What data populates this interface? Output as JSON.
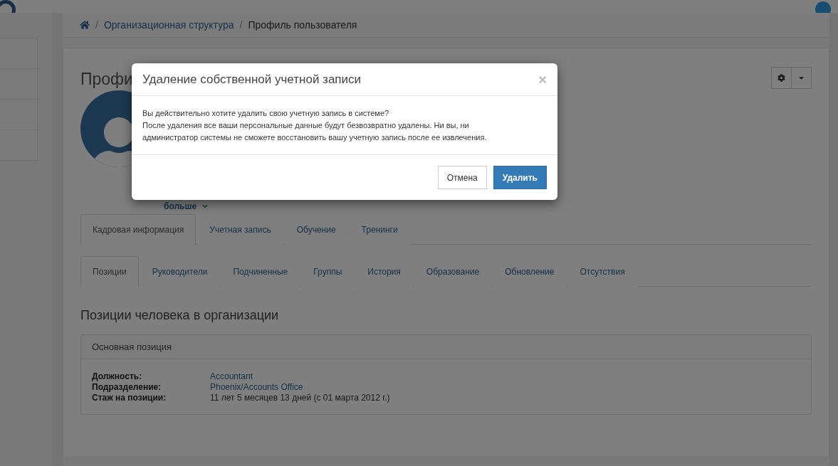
{
  "breadcrumb": {
    "separator": "/",
    "items": [
      "Организационная структура",
      "Профиль пользователя"
    ]
  },
  "profile": {
    "title": "Профи",
    "more_link": "больше"
  },
  "main_tabs": [
    {
      "label": "Кадровая информация",
      "selected": true
    },
    {
      "label": "Учетная запись",
      "selected": false
    },
    {
      "label": "Обучение",
      "selected": false
    },
    {
      "label": "Тренинги",
      "selected": false
    }
  ],
  "sub_tabs": [
    {
      "label": "Позиции",
      "selected": true
    },
    {
      "label": "Руководители",
      "selected": false
    },
    {
      "label": "Подчиненные",
      "selected": false
    },
    {
      "label": "Группы",
      "selected": false
    },
    {
      "label": "История",
      "selected": false
    },
    {
      "label": "Образование",
      "selected": false
    },
    {
      "label": "Обновление",
      "selected": false
    },
    {
      "label": "Отсутствия",
      "selected": false
    }
  ],
  "section_title": "Позиции человека в организации",
  "position_panel": {
    "heading": "Основная позиция",
    "rows": [
      {
        "label": "Должность:",
        "value": "Accountant",
        "kind": "link"
      },
      {
        "label": "Подразделение:",
        "value": "Phoenix/Accounts Office",
        "kind": "link"
      },
      {
        "label": "Стаж на позиции:",
        "value": "11 лет 5 месяцев 13 дней (с 01 марта 2012 г.)",
        "kind": "text"
      }
    ]
  },
  "modal": {
    "title": "Удаление собственной учетной записи",
    "close": "×",
    "body": [
      "Вы действительно хотите удалить свою учетную запись в системе?",
      "После удаления все ваши персональные данные будут безвозвратно удалены. Ни вы, ни администратор системы не сможете восстановить вашу учетную запись после ее извлечения."
    ],
    "buttons": [
      {
        "label": "Отмена",
        "kind": "default"
      },
      {
        "label": "Удалить",
        "kind": "primary"
      }
    ]
  }
}
